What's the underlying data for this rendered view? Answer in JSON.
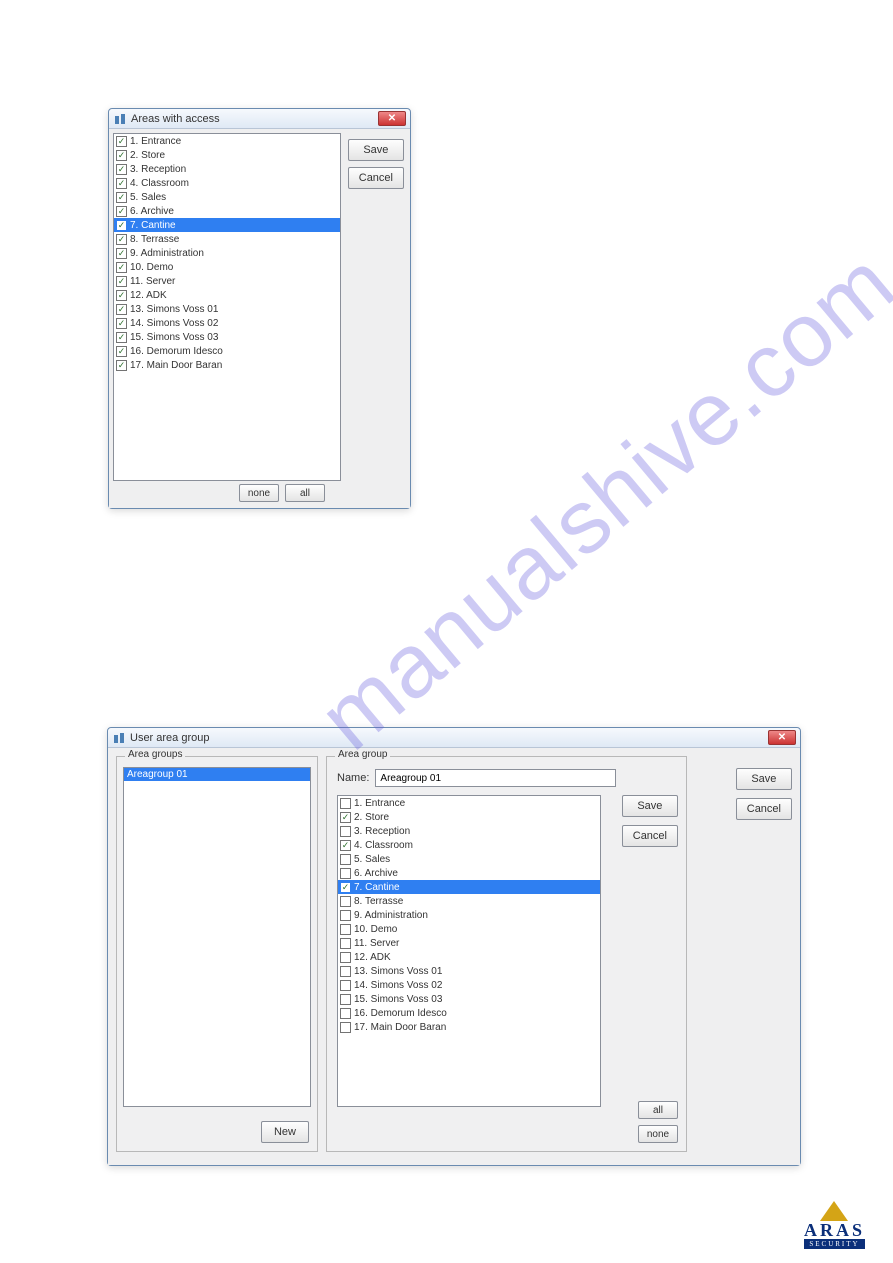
{
  "watermark_text": "manualshive.com",
  "logo": {
    "name": "ARAS",
    "sub": "SECURITY"
  },
  "buttons": {
    "save": "Save",
    "cancel": "Cancel",
    "none": "none",
    "all": "all",
    "new": "New"
  },
  "win1": {
    "title": "Areas with access",
    "selected_index": 6,
    "items": [
      {
        "checked": true,
        "label": "1. Entrance"
      },
      {
        "checked": true,
        "label": "2. Store"
      },
      {
        "checked": true,
        "label": "3. Reception"
      },
      {
        "checked": true,
        "label": "4. Classroom"
      },
      {
        "checked": true,
        "label": "5. Sales"
      },
      {
        "checked": true,
        "label": "6. Archive"
      },
      {
        "checked": true,
        "label": "7. Cantine"
      },
      {
        "checked": true,
        "label": "8. Terrasse"
      },
      {
        "checked": true,
        "label": "9. Administration"
      },
      {
        "checked": true,
        "label": "10. Demo"
      },
      {
        "checked": true,
        "label": "11. Server"
      },
      {
        "checked": true,
        "label": "12. ADK"
      },
      {
        "checked": true,
        "label": "13. Simons Voss 01"
      },
      {
        "checked": true,
        "label": "14. Simons Voss 02"
      },
      {
        "checked": true,
        "label": "15. Simons Voss 03"
      },
      {
        "checked": true,
        "label": "16. Demorum Idesco"
      },
      {
        "checked": true,
        "label": "17. Main Door Baran"
      }
    ]
  },
  "win2": {
    "title": "User area group",
    "legend_left": "Area groups",
    "legend_right": "Area group",
    "name_label": "Name:",
    "name_value": "Areagroup 01",
    "groups_selected": "Areagroup 01",
    "selected_index": 6,
    "items": [
      {
        "checked": false,
        "label": "1. Entrance"
      },
      {
        "checked": true,
        "label": "2. Store"
      },
      {
        "checked": false,
        "label": "3. Reception"
      },
      {
        "checked": true,
        "label": "4. Classroom"
      },
      {
        "checked": false,
        "label": "5. Sales"
      },
      {
        "checked": false,
        "label": "6. Archive"
      },
      {
        "checked": true,
        "label": "7. Cantine"
      },
      {
        "checked": false,
        "label": "8. Terrasse"
      },
      {
        "checked": false,
        "label": "9. Administration"
      },
      {
        "checked": false,
        "label": "10. Demo"
      },
      {
        "checked": false,
        "label": "11. Server"
      },
      {
        "checked": false,
        "label": "12. ADK"
      },
      {
        "checked": false,
        "label": "13. Simons Voss 01"
      },
      {
        "checked": false,
        "label": "14. Simons Voss 02"
      },
      {
        "checked": false,
        "label": "15. Simons Voss 03"
      },
      {
        "checked": false,
        "label": "16. Demorum Idesco"
      },
      {
        "checked": false,
        "label": "17. Main Door Baran"
      }
    ]
  }
}
